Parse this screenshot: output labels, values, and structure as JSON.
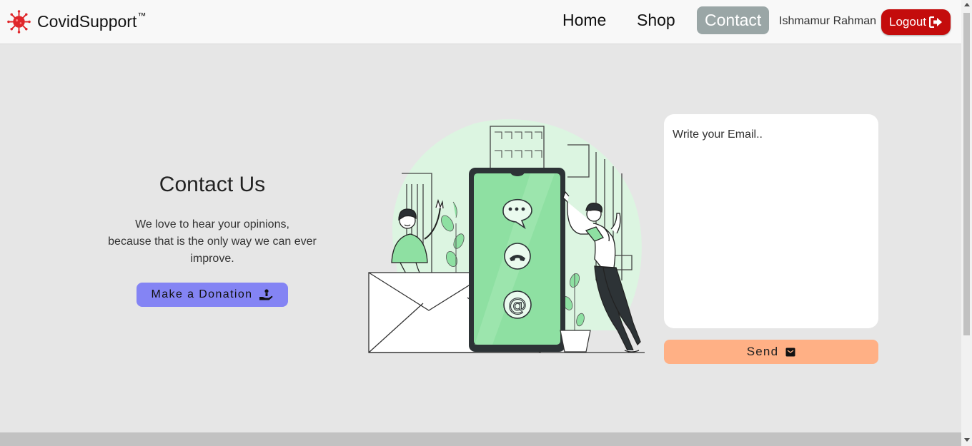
{
  "navbar": {
    "brand": "CovidSupport",
    "brand_mark": "™",
    "links": [
      {
        "label": "Home",
        "active": false
      },
      {
        "label": "Shop",
        "active": false
      },
      {
        "label": "Contact",
        "active": true
      }
    ],
    "username": "Ishmamur Rahman",
    "logout_label": "Logout",
    "logout_icon": "sign-out-icon"
  },
  "contact": {
    "title": "Contact Us",
    "description_line1": "We love to hear your opinions,",
    "description_line2": "because that is the only way we can ever",
    "description_line3": "improve.",
    "donate_label": "Make a Donation",
    "donate_icon": "hand-holding-icon"
  },
  "form": {
    "email_placeholder": "Write your Email..",
    "send_label": "Send",
    "send_icon": "envelope-icon"
  },
  "colors": {
    "accent_active": "#9aa6a6",
    "logout": "#c40c0c",
    "donate": "#8484f4",
    "send": "#ffb085",
    "illustration_green": "#8ee0a2"
  }
}
